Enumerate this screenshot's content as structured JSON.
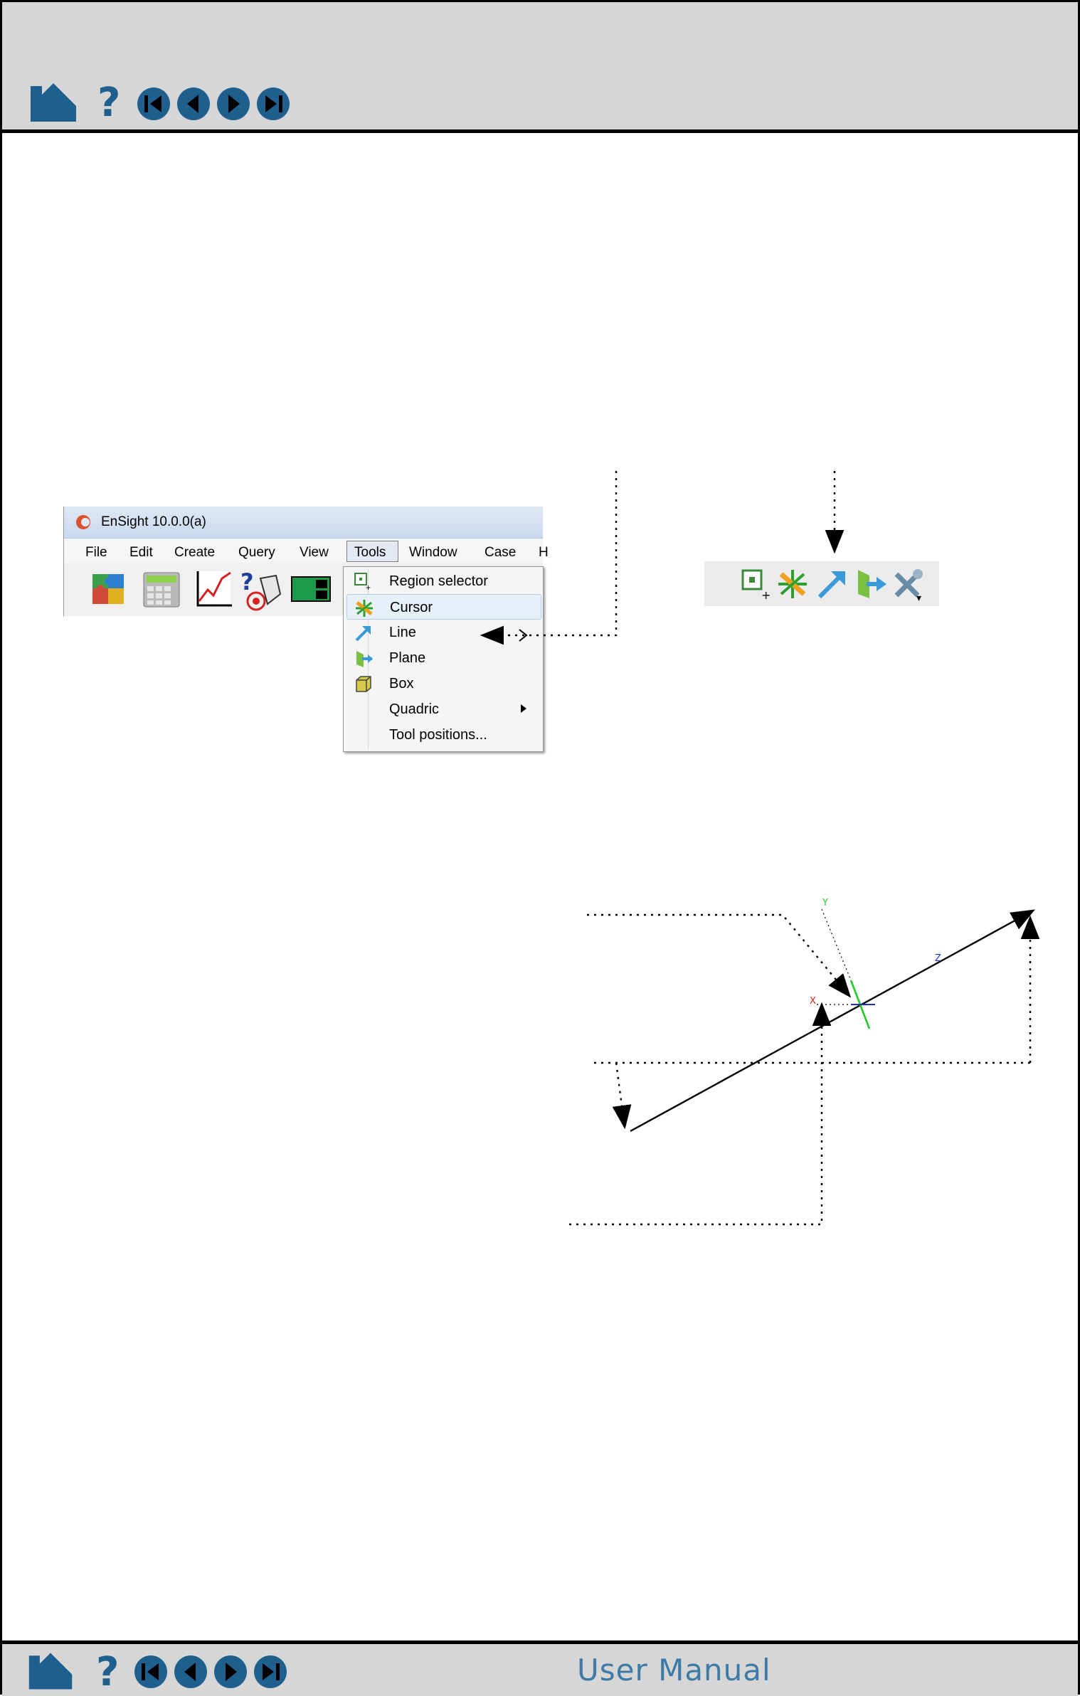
{
  "nav": {
    "icons": [
      "home-icon",
      "help-icon",
      "first-page-icon",
      "previous-page-icon",
      "next-page-icon",
      "last-page-icon"
    ],
    "footer_title": "User Manual",
    "accent": "#1f5f8e"
  },
  "ensight": {
    "title": "EnSight 10.0.0(a)",
    "menus": [
      "File",
      "Edit",
      "Create",
      "Query",
      "View",
      "Tools",
      "Window",
      "Case",
      "H"
    ],
    "tools_menu": [
      "Region selector",
      "Cursor",
      "Line",
      "Plane",
      "Box",
      "Quadric",
      "Tool positions..."
    ]
  },
  "diagram": {
    "axis_labels": {
      "x": "X",
      "y": "Y",
      "z": "Z"
    }
  }
}
